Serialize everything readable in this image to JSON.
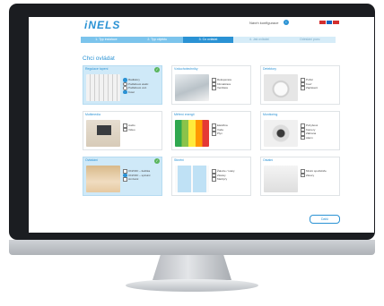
{
  "header": {
    "logo": "iNELS",
    "configurator_label": "Návrh konfigurace",
    "configurator_icon": "info-icon",
    "flag_colors": [
      "#d32f2f",
      "#ffffff",
      "#1565c0",
      "#d32f2f"
    ]
  },
  "steps": [
    {
      "label": "1. Typ instalace",
      "state": "done"
    },
    {
      "label": "2. Typ objektu",
      "state": "done"
    },
    {
      "label": "3. Co ovládat",
      "state": "active"
    },
    {
      "label": "4. Jak ovládat",
      "state": "todo"
    },
    {
      "label": "Odeslání pozv.",
      "state": "todo"
    }
  ],
  "title": "Chci ovládat",
  "cards": [
    {
      "title": "Regulace topení",
      "selected": true,
      "image": "radiator",
      "options": [
        {
          "label": "Radiátory",
          "type": "radio",
          "checked": true
        },
        {
          "label": "Podlahové elektr.",
          "type": "radio",
          "checked": false
        },
        {
          "label": "Podlahové vod.",
          "type": "radio",
          "checked": false
        },
        {
          "label": "Kotel",
          "type": "radio",
          "checked": true
        }
      ]
    },
    {
      "title": "Vzduchotechniky",
      "selected": false,
      "image": "vent",
      "options": [
        {
          "label": "Rekuperace",
          "type": "checkbox",
          "checked": false
        },
        {
          "label": "Klimatizace",
          "type": "checkbox",
          "checked": false
        },
        {
          "label": "Ventilace",
          "type": "checkbox",
          "checked": false
        }
      ]
    },
    {
      "title": "Detektory",
      "selected": false,
      "image": "smoke",
      "options": [
        {
          "label": "Požár",
          "type": "checkbox",
          "checked": false
        },
        {
          "label": "Kouř",
          "type": "checkbox",
          "checked": false
        },
        {
          "label": "Zaplavení",
          "type": "checkbox",
          "checked": false
        }
      ]
    },
    {
      "title": "Multimedia",
      "selected": false,
      "image": "tv",
      "options": [
        {
          "label": "Audio",
          "type": "checkbox",
          "checked": false
        },
        {
          "label": "Video",
          "type": "checkbox",
          "checked": false
        }
      ]
    },
    {
      "title": "Měření energií",
      "selected": false,
      "image": "energy",
      "options": [
        {
          "label": "Elektřina",
          "type": "checkbox",
          "checked": false
        },
        {
          "label": "Voda",
          "type": "checkbox",
          "checked": false
        },
        {
          "label": "Plyn",
          "type": "checkbox",
          "checked": false
        }
      ]
    },
    {
      "title": "Monitoring",
      "selected": false,
      "image": "camera",
      "options": [
        {
          "label": "Pohybové",
          "type": "checkbox",
          "checked": false
        },
        {
          "label": "Kamery",
          "type": "checkbox",
          "checked": false
        },
        {
          "label": "Zábrana",
          "type": "checkbox",
          "checked": false
        },
        {
          "label": "Alarm",
          "type": "checkbox",
          "checked": false
        }
      ]
    },
    {
      "title": "Ovládání",
      "selected": true,
      "image": "heater",
      "options": [
        {
          "label": "ON/OFF – tlačítka",
          "type": "checkbox",
          "checked": false
        },
        {
          "label": "ON/OFF – spínání",
          "type": "radio",
          "checked": true
        },
        {
          "label": "stmívání",
          "type": "checkbox",
          "checked": false
        }
      ]
    },
    {
      "title": "Stínění",
      "selected": false,
      "image": "window",
      "options": [
        {
          "label": "Žaluzie / rolety",
          "type": "checkbox",
          "checked": false
        },
        {
          "label": "Závěsy",
          "type": "checkbox",
          "checked": false
        },
        {
          "label": "Markýzy",
          "type": "checkbox",
          "checked": false
        }
      ]
    },
    {
      "title": "Ostatní",
      "selected": false,
      "image": "socket",
      "options": [
        {
          "label": "Místní spotřebiče",
          "type": "checkbox",
          "checked": false
        },
        {
          "label": "Závory",
          "type": "checkbox",
          "checked": false
        }
      ]
    }
  ],
  "next_button": "Další"
}
